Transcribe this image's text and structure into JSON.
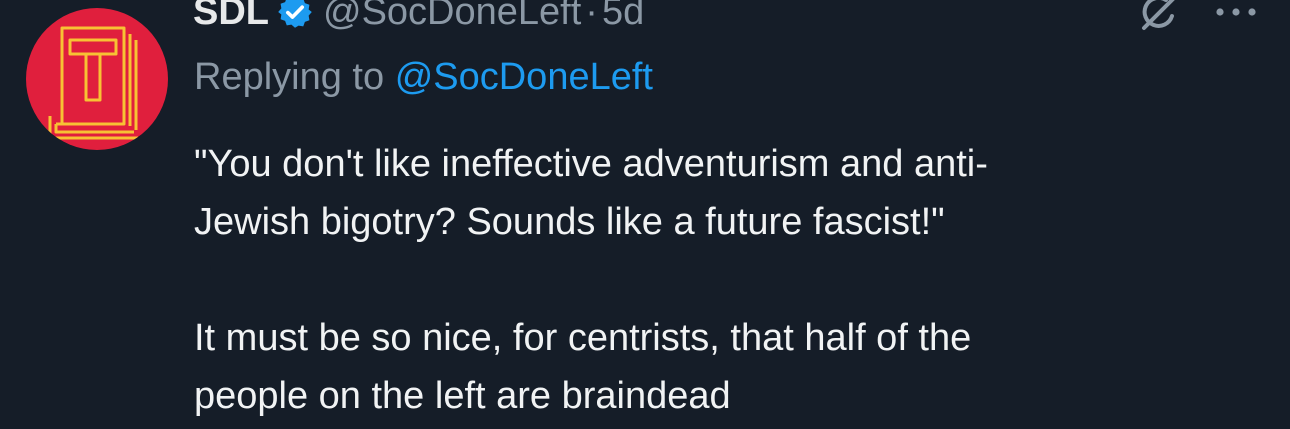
{
  "tweet": {
    "display_name": "SDL",
    "handle": "@SocDoneLeft",
    "separator": "·",
    "time": "5d",
    "replying_prefix": "Replying to",
    "replying_handle": "@SocDoneLeft",
    "body_line_1": "\"You don't like ineffective adventurism and anti-",
    "body_line_2": "Jewish bigotry? Sounds like a future fascist!\"",
    "body_line_3": "It must be so nice, for centrists, that half of the",
    "body_line_4": "people on the left are braindead"
  },
  "icons": {
    "avatar": "book-hammer-logo",
    "verified": "verified-badge-icon",
    "grok": "grok-icon",
    "more": "more-options-icon"
  },
  "colors": {
    "background": "#151d28",
    "text": "#e7e9ea",
    "muted": "#8b98a5",
    "link": "#1d9bf0",
    "avatar_bg": "#e01f3d",
    "avatar_fg": "#f7c234"
  }
}
